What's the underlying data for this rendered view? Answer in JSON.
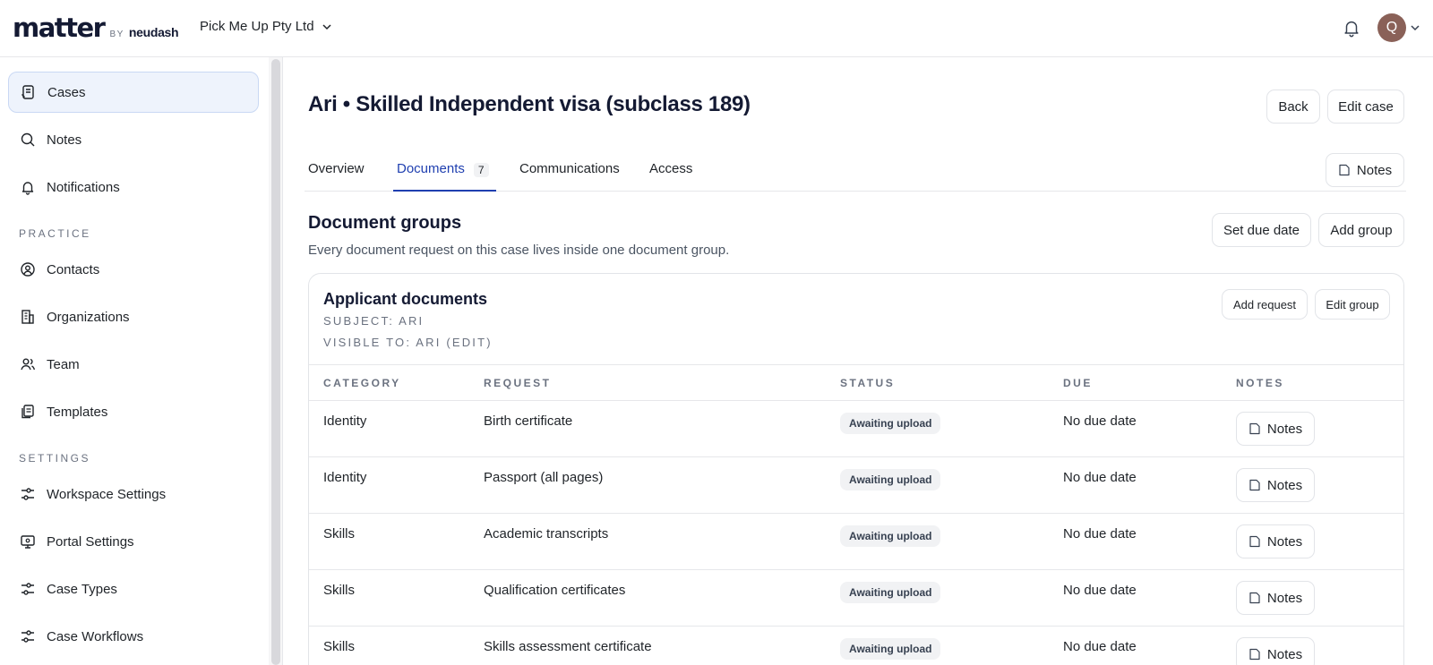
{
  "brand": {
    "name": "matter",
    "by": "BY",
    "partner": "neudash"
  },
  "header": {
    "org_name": "Pick Me Up Pty Ltd",
    "avatar_initial": "Q"
  },
  "sidebar": {
    "items": [
      {
        "label": "Cases",
        "icon": "cases-icon"
      },
      {
        "label": "Notes",
        "icon": "search-icon"
      },
      {
        "label": "Notifications",
        "icon": "bell-icon"
      }
    ],
    "practice_label": "PRACTICE",
    "practice_items": [
      {
        "label": "Contacts",
        "icon": "contacts-icon"
      },
      {
        "label": "Organizations",
        "icon": "building-icon"
      },
      {
        "label": "Team",
        "icon": "team-icon"
      },
      {
        "label": "Templates",
        "icon": "templates-icon"
      }
    ],
    "settings_label": "SETTINGS",
    "settings_items": [
      {
        "label": "Workspace Settings",
        "icon": "sliders-icon"
      },
      {
        "label": "Portal Settings",
        "icon": "portal-icon"
      },
      {
        "label": "Case Types",
        "icon": "sliders-icon"
      },
      {
        "label": "Case Workflows",
        "icon": "sliders-icon"
      }
    ]
  },
  "page": {
    "title": "Ari • Skilled Independent visa (subclass 189)",
    "back_label": "Back",
    "edit_case_label": "Edit case",
    "notes_label": "Notes"
  },
  "tabs": [
    {
      "label": "Overview"
    },
    {
      "label": "Documents",
      "count": "7"
    },
    {
      "label": "Communications"
    },
    {
      "label": "Access"
    }
  ],
  "document_groups": {
    "title": "Document groups",
    "subtitle": "Every document request on this case lives inside one document group.",
    "set_due_date_label": "Set due date",
    "add_group_label": "Add group"
  },
  "group": {
    "title": "Applicant documents",
    "subject": "SUBJECT: ARI",
    "visible_to": "VISIBLE TO: ARI (EDIT)",
    "add_request_label": "Add request",
    "edit_group_label": "Edit group",
    "columns": [
      "CATEGORY",
      "REQUEST",
      "STATUS",
      "DUE",
      "NOTES"
    ],
    "rows": [
      {
        "category": "Identity",
        "request": "Birth certificate",
        "status": "Awaiting upload",
        "due": "No due date",
        "notes": "Notes"
      },
      {
        "category": "Identity",
        "request": "Passport (all pages)",
        "status": "Awaiting upload",
        "due": "No due date",
        "notes": "Notes"
      },
      {
        "category": "Skills",
        "request": "Academic transcripts",
        "status": "Awaiting upload",
        "due": "No due date",
        "notes": "Notes"
      },
      {
        "category": "Skills",
        "request": "Qualification certificates",
        "status": "Awaiting upload",
        "due": "No due date",
        "notes": "Notes"
      },
      {
        "category": "Skills",
        "request": "Skills assessment certificate",
        "status": "Awaiting upload",
        "due": "No due date",
        "notes": "Notes"
      }
    ]
  },
  "colors": {
    "accent": "#1f3fb0",
    "active_nav_bg": "#eef3fc",
    "avatar_bg": "#8a6158"
  }
}
